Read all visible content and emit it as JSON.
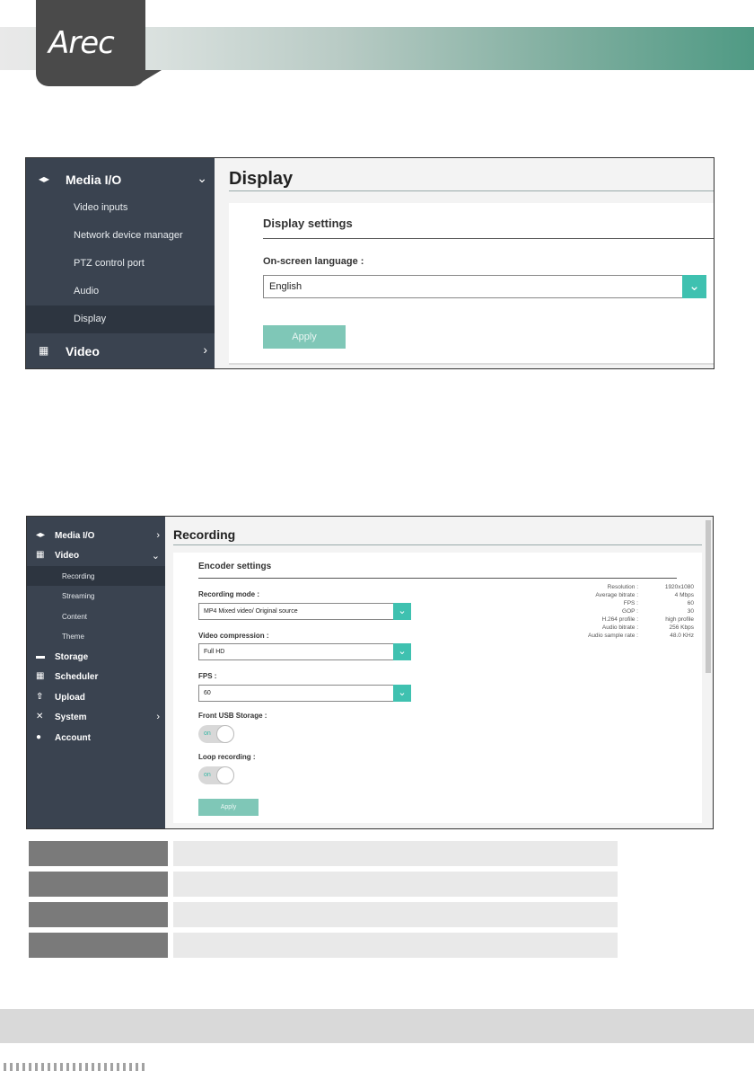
{
  "brand": {
    "logo": "Arec"
  },
  "display_screen": {
    "sidebar": {
      "media_io": {
        "label": "Media I/O",
        "icon": "media-io-icon",
        "state": "expanded"
      },
      "items": [
        "Video inputs",
        "Network device manager",
        "PTZ control port",
        "Audio",
        "Display"
      ],
      "active_item": "Display",
      "video": {
        "label": "Video",
        "icon": "video-icon",
        "state": "collapsed"
      }
    },
    "page_title": "Display",
    "section_title": "Display settings",
    "language_label": "On-screen language :",
    "language_value": "English",
    "apply_label": "Apply"
  },
  "recording_screen": {
    "sidebar": {
      "groups": [
        {
          "label": "Media I/O",
          "icon": "media-io-icon",
          "chevron": "collapsed"
        },
        {
          "label": "Video",
          "icon": "video-icon",
          "chevron": "expanded"
        },
        {
          "label": "Storage",
          "icon": "storage-icon"
        },
        {
          "label": "Scheduler",
          "icon": "scheduler-icon"
        },
        {
          "label": "Upload",
          "icon": "upload-icon"
        },
        {
          "label": "System",
          "icon": "system-icon",
          "chevron": "collapsed"
        },
        {
          "label": "Account",
          "icon": "account-icon"
        }
      ],
      "video_items": [
        "Recording",
        "Streaming",
        "Content",
        "Theme"
      ],
      "active_item": "Recording"
    },
    "page_title": "Recording",
    "section_title": "Encoder settings",
    "recording_mode_label": "Recording mode :",
    "recording_mode_value": "MP4 Mixed video/ Original source",
    "video_compression_label": "Video compression :",
    "video_compression_value": "Full HD",
    "fps_label": "FPS :",
    "fps_value": "60",
    "front_usb_label": "Front USB Storage :",
    "front_usb_toggle": "on",
    "loop_recording_label": "Loop recording :",
    "loop_recording_toggle": "on",
    "apply_label": "Apply",
    "stats": [
      {
        "key": "Resolution :",
        "value": "1920x1080"
      },
      {
        "key": "Average bitrate :",
        "value": "4 Mbps"
      },
      {
        "key": "FPS :",
        "value": "60"
      },
      {
        "key": "GOP :",
        "value": "30"
      },
      {
        "key": "H.264 profile :",
        "value": "high profile"
      },
      {
        "key": "Audio bitrate :",
        "value": "256 Kbps"
      },
      {
        "key": "Audio sample rate :",
        "value": "48.0 KHz"
      }
    ]
  },
  "colors": {
    "sidebar_bg": "#3a4350",
    "accent": "#3fc1b0",
    "apply_button": "#7fc7b7"
  }
}
